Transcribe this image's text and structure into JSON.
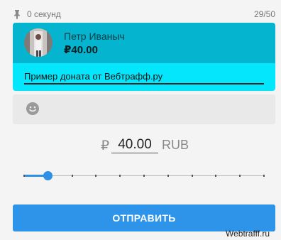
{
  "header": {
    "timer_text": "0 секунд",
    "counter_text": "29/50",
    "pin_icon": "pin-icon"
  },
  "donation": {
    "donor_name": "Петр Иваныч",
    "amount_text": "₽40.00",
    "message": "Пример доната от Вебтрафф.ру",
    "head_color": "#05b4cf",
    "body_color": "#04e6fb"
  },
  "emoji": {
    "icon": "emoji-icon"
  },
  "amount": {
    "currency_symbol": "₽",
    "value": "40.00",
    "currency_code": "RUB"
  },
  "slider": {
    "value_fraction": 0.1,
    "tick_count": 11,
    "accent_color": "#2d8fe6"
  },
  "submit": {
    "label": "ОТПРАВИТЬ",
    "color": "#2d94e9"
  },
  "watermark": {
    "text": "Webtrafff.ru"
  }
}
